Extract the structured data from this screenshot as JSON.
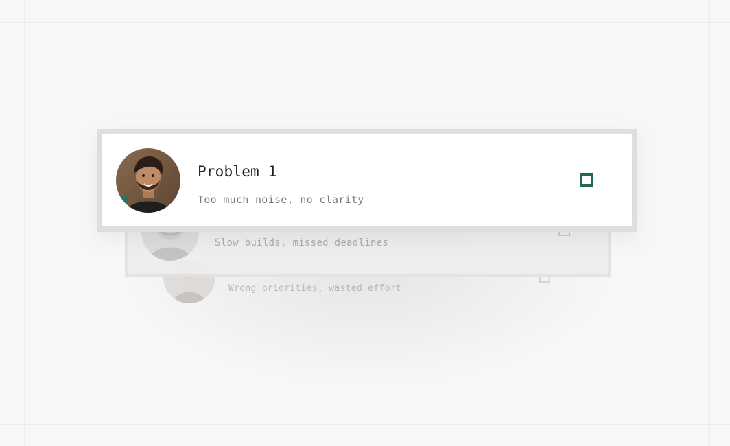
{
  "colors": {
    "background": "#f7f7f7",
    "card_border": "#dedede",
    "accent": "#1f6b4a",
    "title_text": "#1f1f1f",
    "subtitle_text": "#7b7b7b"
  },
  "cards": [
    {
      "title": "Problem 1",
      "subtitle": "Too much noise, no clarity",
      "avatar": "person-avatar",
      "checkbox_icon": "checkbox-outline-icon"
    },
    {
      "subtitle": "Slow builds, missed deadlines",
      "avatar": "person-avatar",
      "checkbox_icon": "checkbox-outline-icon"
    },
    {
      "subtitle": "Wrong priorities, wasted effort",
      "avatar": "person-avatar",
      "checkbox_icon": "checkbox-outline-icon"
    }
  ]
}
